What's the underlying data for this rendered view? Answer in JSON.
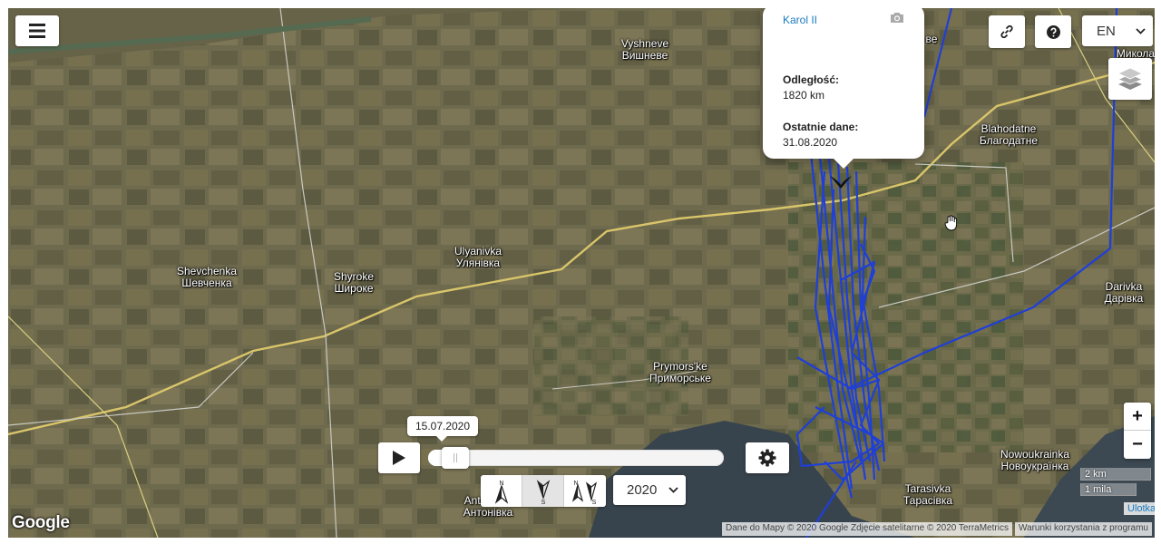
{
  "map": {
    "places": [
      {
        "id": "vyshneve",
        "latin": "Vyshneve",
        "cyrillic": "Вишневе"
      },
      {
        "id": "blahodatne",
        "latin": "Blahodatne",
        "cyrillic": "Благодатне"
      },
      {
        "id": "ulyanivka",
        "latin": "Ulyanivka",
        "cyrillic": "Улянівка"
      },
      {
        "id": "shevchenka",
        "latin": "Shevchenka",
        "cyrillic": "Шевченка"
      },
      {
        "id": "shyroke",
        "latin": "Shyroke",
        "cyrillic": "Широке"
      },
      {
        "id": "darivka",
        "latin": "Darivka",
        "cyrillic": "Дарівка"
      },
      {
        "id": "prymorske",
        "latin": "Prymors'ke",
        "cyrillic": "Приморське"
      },
      {
        "id": "nowoukrainka",
        "latin": "Nowoukrainka",
        "cyrillic": "Новоукраїнка"
      },
      {
        "id": "tarasivka",
        "latin": "Tarasivka",
        "cyrillic": "Тарасівка"
      },
      {
        "id": "antonivka",
        "latin": "Antonivka",
        "cyrillic": "Антонівка"
      },
      {
        "id": "mykola",
        "latin": "",
        "cyrillic": "Микола"
      },
      {
        "id": "edge-ve",
        "latin": "",
        "cyrillic": "ве"
      }
    ],
    "track_color": "#1f3fd8",
    "map_colors": {
      "road": "#d9c56a",
      "bg": "#6f6a4f"
    }
  },
  "toolbar": {
    "menu_icon": "hamburger-menu-icon",
    "link_icon": "link-icon",
    "help_icon": "question-icon",
    "language": "EN",
    "layers_icon": "layers-icon"
  },
  "popup": {
    "title": "Karol II",
    "camera_icon": "camera-icon",
    "distance_label": "Odległość:",
    "distance_value": "1820 km",
    "last_data_label": "Ostatnie dane:",
    "last_data_value": "31.08.2020"
  },
  "player": {
    "current_date": "15.07.2020",
    "progress_fraction": 0.05,
    "play_icon": "play-icon",
    "settings_icon": "gear-icon",
    "directions": [
      {
        "id": "north",
        "top": "N",
        "bottom": "",
        "active": false
      },
      {
        "id": "south",
        "top": "",
        "bottom": "S",
        "active": true
      },
      {
        "id": "north-south",
        "top": "N",
        "bottom": "S",
        "active": false
      }
    ],
    "year": "2020"
  },
  "zoom": {
    "in": "+",
    "out": "−"
  },
  "scale": {
    "km": "2 km",
    "mi": "1 mila"
  },
  "attribution": {
    "logo": "Google",
    "data": "Dane do Mapy © 2020 Google Zdjęcie satelitarne © 2020 TerraMetrics",
    "terms": "Warunki korzystania z programu",
    "leaflet": "Ulotka"
  }
}
